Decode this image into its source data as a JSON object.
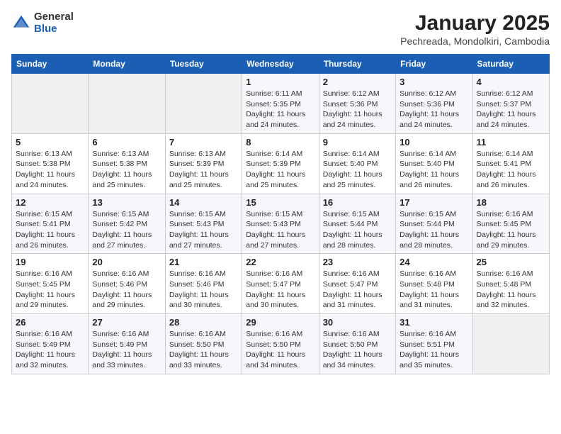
{
  "logo": {
    "general": "General",
    "blue": "Blue"
  },
  "title": {
    "month": "January 2025",
    "location": "Pechreada, Mondolkiri, Cambodia"
  },
  "weekdays": [
    "Sunday",
    "Monday",
    "Tuesday",
    "Wednesday",
    "Thursday",
    "Friday",
    "Saturday"
  ],
  "weeks": [
    [
      {
        "day": "",
        "info": ""
      },
      {
        "day": "",
        "info": ""
      },
      {
        "day": "",
        "info": ""
      },
      {
        "day": "1",
        "info": "Sunrise: 6:11 AM\nSunset: 5:35 PM\nDaylight: 11 hours and 24 minutes."
      },
      {
        "day": "2",
        "info": "Sunrise: 6:12 AM\nSunset: 5:36 PM\nDaylight: 11 hours and 24 minutes."
      },
      {
        "day": "3",
        "info": "Sunrise: 6:12 AM\nSunset: 5:36 PM\nDaylight: 11 hours and 24 minutes."
      },
      {
        "day": "4",
        "info": "Sunrise: 6:12 AM\nSunset: 5:37 PM\nDaylight: 11 hours and 24 minutes."
      }
    ],
    [
      {
        "day": "5",
        "info": "Sunrise: 6:13 AM\nSunset: 5:38 PM\nDaylight: 11 hours and 24 minutes."
      },
      {
        "day": "6",
        "info": "Sunrise: 6:13 AM\nSunset: 5:38 PM\nDaylight: 11 hours and 25 minutes."
      },
      {
        "day": "7",
        "info": "Sunrise: 6:13 AM\nSunset: 5:39 PM\nDaylight: 11 hours and 25 minutes."
      },
      {
        "day": "8",
        "info": "Sunrise: 6:14 AM\nSunset: 5:39 PM\nDaylight: 11 hours and 25 minutes."
      },
      {
        "day": "9",
        "info": "Sunrise: 6:14 AM\nSunset: 5:40 PM\nDaylight: 11 hours and 25 minutes."
      },
      {
        "day": "10",
        "info": "Sunrise: 6:14 AM\nSunset: 5:40 PM\nDaylight: 11 hours and 26 minutes."
      },
      {
        "day": "11",
        "info": "Sunrise: 6:14 AM\nSunset: 5:41 PM\nDaylight: 11 hours and 26 minutes."
      }
    ],
    [
      {
        "day": "12",
        "info": "Sunrise: 6:15 AM\nSunset: 5:41 PM\nDaylight: 11 hours and 26 minutes."
      },
      {
        "day": "13",
        "info": "Sunrise: 6:15 AM\nSunset: 5:42 PM\nDaylight: 11 hours and 27 minutes."
      },
      {
        "day": "14",
        "info": "Sunrise: 6:15 AM\nSunset: 5:43 PM\nDaylight: 11 hours and 27 minutes."
      },
      {
        "day": "15",
        "info": "Sunrise: 6:15 AM\nSunset: 5:43 PM\nDaylight: 11 hours and 27 minutes."
      },
      {
        "day": "16",
        "info": "Sunrise: 6:15 AM\nSunset: 5:44 PM\nDaylight: 11 hours and 28 minutes."
      },
      {
        "day": "17",
        "info": "Sunrise: 6:15 AM\nSunset: 5:44 PM\nDaylight: 11 hours and 28 minutes."
      },
      {
        "day": "18",
        "info": "Sunrise: 6:16 AM\nSunset: 5:45 PM\nDaylight: 11 hours and 29 minutes."
      }
    ],
    [
      {
        "day": "19",
        "info": "Sunrise: 6:16 AM\nSunset: 5:45 PM\nDaylight: 11 hours and 29 minutes."
      },
      {
        "day": "20",
        "info": "Sunrise: 6:16 AM\nSunset: 5:46 PM\nDaylight: 11 hours and 29 minutes."
      },
      {
        "day": "21",
        "info": "Sunrise: 6:16 AM\nSunset: 5:46 PM\nDaylight: 11 hours and 30 minutes."
      },
      {
        "day": "22",
        "info": "Sunrise: 6:16 AM\nSunset: 5:47 PM\nDaylight: 11 hours and 30 minutes."
      },
      {
        "day": "23",
        "info": "Sunrise: 6:16 AM\nSunset: 5:47 PM\nDaylight: 11 hours and 31 minutes."
      },
      {
        "day": "24",
        "info": "Sunrise: 6:16 AM\nSunset: 5:48 PM\nDaylight: 11 hours and 31 minutes."
      },
      {
        "day": "25",
        "info": "Sunrise: 6:16 AM\nSunset: 5:48 PM\nDaylight: 11 hours and 32 minutes."
      }
    ],
    [
      {
        "day": "26",
        "info": "Sunrise: 6:16 AM\nSunset: 5:49 PM\nDaylight: 11 hours and 32 minutes."
      },
      {
        "day": "27",
        "info": "Sunrise: 6:16 AM\nSunset: 5:49 PM\nDaylight: 11 hours and 33 minutes."
      },
      {
        "day": "28",
        "info": "Sunrise: 6:16 AM\nSunset: 5:50 PM\nDaylight: 11 hours and 33 minutes."
      },
      {
        "day": "29",
        "info": "Sunrise: 6:16 AM\nSunset: 5:50 PM\nDaylight: 11 hours and 34 minutes."
      },
      {
        "day": "30",
        "info": "Sunrise: 6:16 AM\nSunset: 5:50 PM\nDaylight: 11 hours and 34 minutes."
      },
      {
        "day": "31",
        "info": "Sunrise: 6:16 AM\nSunset: 5:51 PM\nDaylight: 11 hours and 35 minutes."
      },
      {
        "day": "",
        "info": ""
      }
    ]
  ]
}
